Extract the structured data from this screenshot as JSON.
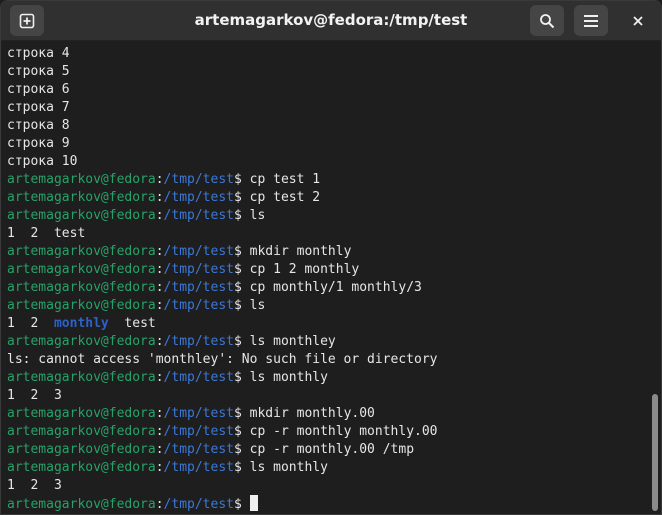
{
  "window": {
    "title": "artemagarkov@fedora:/tmp/test",
    "icons": {
      "new_tab": "plus-square-icon",
      "search": "search-icon",
      "menu": "hamburger-menu-icon",
      "close": "close-icon"
    }
  },
  "terminal": {
    "prompt_user": "artemagarkov@fedora",
    "prompt_path": "/tmp/test",
    "lines": [
      {
        "type": "output",
        "text": "строка 4"
      },
      {
        "type": "output",
        "text": "строка 5"
      },
      {
        "type": "output",
        "text": "строка 6"
      },
      {
        "type": "output",
        "text": "строка 7"
      },
      {
        "type": "output",
        "text": "строка 8"
      },
      {
        "type": "output",
        "text": "строка 9"
      },
      {
        "type": "output",
        "text": "строка 10"
      },
      {
        "type": "command",
        "text": "cp test 1"
      },
      {
        "type": "command",
        "text": "cp test 2"
      },
      {
        "type": "command",
        "text": "ls"
      },
      {
        "type": "ls",
        "items": [
          {
            "name": "1",
            "dir": false
          },
          {
            "name": "2",
            "dir": false
          },
          {
            "name": "test",
            "dir": false
          }
        ]
      },
      {
        "type": "command",
        "text": "mkdir monthly"
      },
      {
        "type": "command",
        "text": "cp 1 2 monthly"
      },
      {
        "type": "command",
        "text": "cp monthly/1 monthly/3"
      },
      {
        "type": "command",
        "text": "ls"
      },
      {
        "type": "ls",
        "items": [
          {
            "name": "1",
            "dir": false
          },
          {
            "name": "2",
            "dir": false
          },
          {
            "name": "monthly",
            "dir": true
          },
          {
            "name": "test",
            "dir": false
          }
        ]
      },
      {
        "type": "command",
        "text": "ls monthley"
      },
      {
        "type": "output",
        "text": "ls: cannot access 'monthley': No such file or directory"
      },
      {
        "type": "command",
        "text": "ls monthly"
      },
      {
        "type": "ls",
        "items": [
          {
            "name": "1",
            "dir": false
          },
          {
            "name": "2",
            "dir": false
          },
          {
            "name": "3",
            "dir": false
          }
        ]
      },
      {
        "type": "command",
        "text": "mkdir monthly.00"
      },
      {
        "type": "command",
        "text": "cp -r monthly monthly.00"
      },
      {
        "type": "command",
        "text": "cp -r monthly.00 /tmp"
      },
      {
        "type": "command",
        "text": "ls monthly"
      },
      {
        "type": "ls",
        "items": [
          {
            "name": "1",
            "dir": false
          },
          {
            "name": "2",
            "dir": false
          },
          {
            "name": "3",
            "dir": false
          }
        ]
      },
      {
        "type": "prompt",
        "text": ""
      }
    ]
  },
  "colors": {
    "user": "#26a269",
    "path": "#3b78d8",
    "directory": "#2a62c9",
    "background": "#1e1e1e",
    "text": "#e6e6e6"
  }
}
